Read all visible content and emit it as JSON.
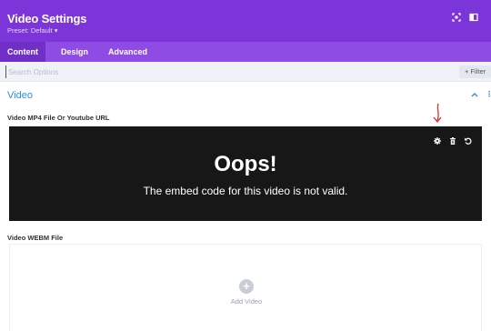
{
  "header": {
    "title": "Video Settings",
    "preset": "Preset: Default ▾",
    "background": "#7b35d9",
    "icons": [
      "expand-icon",
      "sidebar-toggle-icon"
    ]
  },
  "tabs": [
    {
      "label": "Content",
      "active": true
    },
    {
      "label": "Design",
      "active": false
    },
    {
      "label": "Advanced",
      "active": false
    }
  ],
  "search": {
    "placeholder": "Search Options",
    "value": "",
    "filter_label": "+ Filter"
  },
  "section": {
    "title": "Video",
    "collapse_icon": "chevron-up-icon",
    "more_icon": "more-options-icon",
    "accent": "#2e8fd8"
  },
  "video_field": {
    "label": "Video MP4 File Or Youtube URL",
    "heading": "Oops!",
    "message": "The embed code for this video is not valid.",
    "icons": [
      "gear-icon",
      "trash-icon",
      "reset-icon"
    ],
    "annotation_icon": "red-arrow-down-icon"
  },
  "webm_field": {
    "label": "Video WEBM File",
    "add_label": "Add Video",
    "add_icon": "plus-circle-icon"
  }
}
